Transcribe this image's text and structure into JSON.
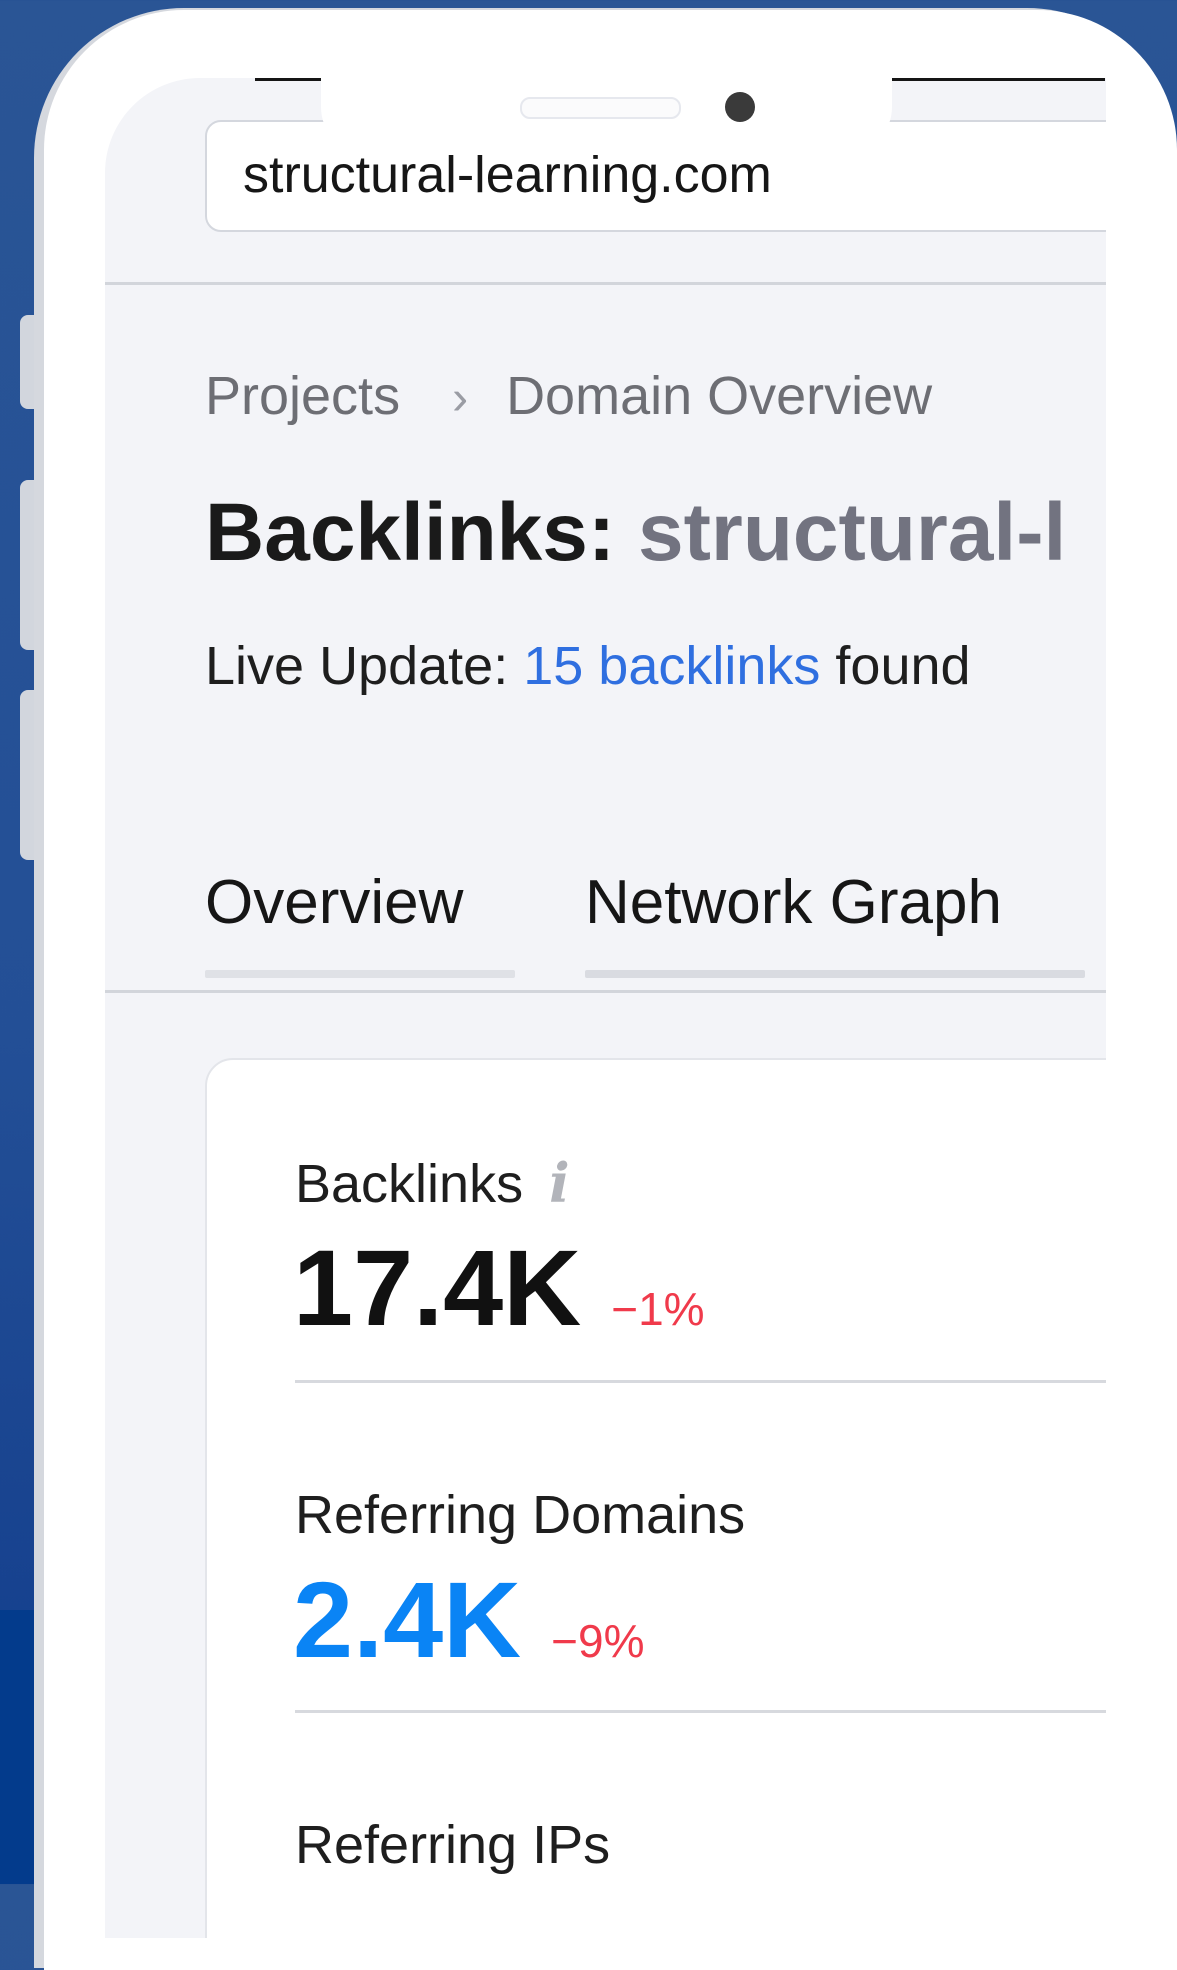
{
  "address_bar": {
    "url": "structural-learning.com"
  },
  "breadcrumb": {
    "items": [
      "Projects",
      "Domain Overview"
    ],
    "separator": "›"
  },
  "title": {
    "prefix": "Backlinks:",
    "domain": "structural-l"
  },
  "live_update": {
    "label": "Live Update:",
    "link": "15 backlinks",
    "suffix": "found"
  },
  "tabs": [
    {
      "label": "Overview"
    },
    {
      "label": "Network Graph"
    }
  ],
  "metrics": [
    {
      "label": "Backlinks",
      "value": "17.4K",
      "change": "−1%",
      "has_info_icon": true
    },
    {
      "label": "Referring Domains",
      "value": "2.4K",
      "change": "−9%"
    },
    {
      "label": "Referring IPs"
    }
  ],
  "colors": {
    "background": "#234f96",
    "screen": "#f3f4f8",
    "link": "#2f6fe0",
    "value_blue": "#0a84f5",
    "negative_change": "#f03a4b"
  }
}
